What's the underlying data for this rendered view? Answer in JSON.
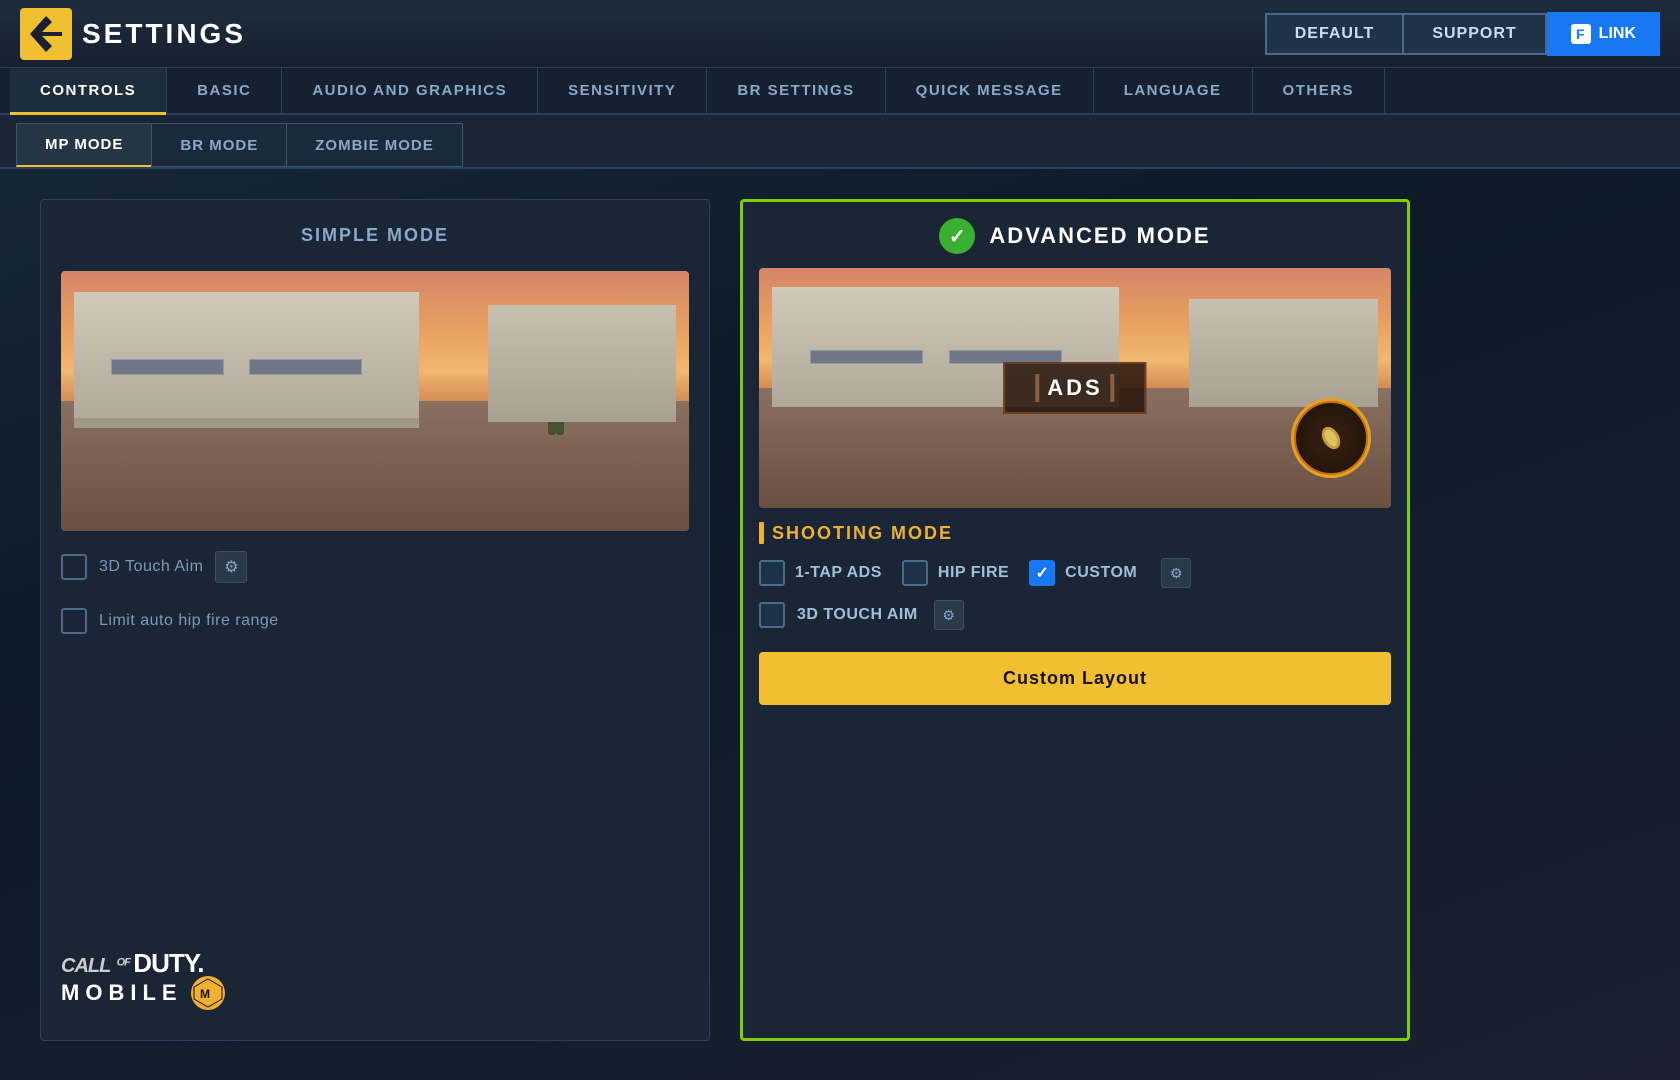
{
  "header": {
    "title": "SETTINGS",
    "buttons": {
      "default": "DEFAULT",
      "support": "SUPPORT",
      "link": "LINK"
    }
  },
  "main_tabs": [
    {
      "id": "controls",
      "label": "CONTROLS",
      "active": true
    },
    {
      "id": "basic",
      "label": "BASIC",
      "active": false
    },
    {
      "id": "audio_graphics",
      "label": "AUDIO AND GRAPHICS",
      "active": false
    },
    {
      "id": "sensitivity",
      "label": "SENSITIVITY",
      "active": false
    },
    {
      "id": "br_settings",
      "label": "BR SETTINGS",
      "active": false
    },
    {
      "id": "quick_message",
      "label": "QUICK MESSAGE",
      "active": false
    },
    {
      "id": "language",
      "label": "LANGUAGE",
      "active": false
    },
    {
      "id": "others",
      "label": "OTHERS",
      "active": false
    }
  ],
  "sub_tabs": [
    {
      "id": "mp_mode",
      "label": "MP MODE",
      "active": true
    },
    {
      "id": "br_mode",
      "label": "BR MODE",
      "active": false
    },
    {
      "id": "zombie_mode",
      "label": "ZOMBIE MODE",
      "active": false
    }
  ],
  "left_panel": {
    "title": "SIMPLE MODE",
    "option1_label": "3D Touch Aim",
    "option2_label": "Limit auto hip fire range"
  },
  "right_panel": {
    "title": "ADVANCED MODE",
    "ads_label": "ADS",
    "shooting_mode_title": "SHOOTING MODE",
    "option1_label": "1-tap ADS",
    "option2_label": "HIP FIRE",
    "option3_label": "CUSTOM",
    "touch_aim_label": "3D Touch Aim",
    "custom_layout_btn": "Custom Layout"
  },
  "cod_logo": {
    "line1": "CALL OF DUTY.",
    "line2": "MOBILE",
    "badge": "M"
  }
}
